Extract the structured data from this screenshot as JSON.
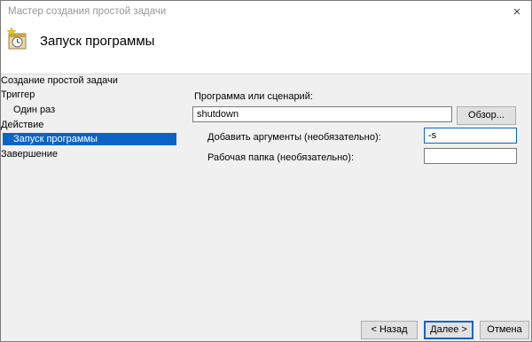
{
  "window": {
    "title": "Мастер создания простой задачи",
    "close_icon": "×"
  },
  "header": {
    "title": "Запуск программы",
    "icon": "scheduled-task-clock-icon"
  },
  "sidebar": {
    "items": [
      {
        "label": "Создание простой задачи"
      },
      {
        "label": "Триггер"
      },
      {
        "label": "Один раз"
      },
      {
        "label": "Действие"
      },
      {
        "label": "Запуск программы"
      },
      {
        "label": "Завершение"
      }
    ]
  },
  "form": {
    "program_label": "Программа или сценарий:",
    "program_value": "shutdown",
    "browse_label": "Обзор...",
    "args_label": "Добавить аргументы (необязательно):",
    "args_value": "-s",
    "workdir_label": "Рабочая папка (необязательно):",
    "workdir_value": ""
  },
  "footer": {
    "back_label": "< Назад",
    "next_label": "Далее >",
    "cancel_label": "Отмена"
  },
  "colors": {
    "selection": "#0a64c8",
    "window_bg": "#f0f0f0",
    "header_bg": "#ffffff"
  }
}
